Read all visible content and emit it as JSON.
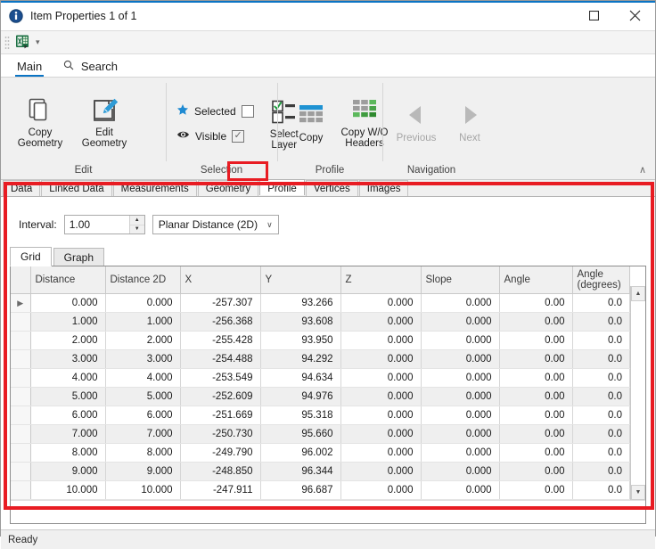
{
  "window": {
    "title": "Item Properties 1 of 1",
    "icon": "info-icon",
    "maximize_label": "□",
    "close_label": "✕"
  },
  "quick_access": {
    "export_excel_icon": "excel-export-icon",
    "dropdown_caret": "▾"
  },
  "ribbon": {
    "tabs": [
      {
        "label": "Main",
        "active": true
      },
      {
        "label": "Search",
        "active": false,
        "icon": "search-icon"
      }
    ],
    "collapse_label": "∧",
    "groups": [
      {
        "name": "Edit",
        "label": "Edit",
        "buttons": [
          {
            "label": "Copy Geometry",
            "icon": "copy-geometry-icon",
            "disabled": false
          },
          {
            "label": "Edit Geometry",
            "icon": "edit-geometry-icon",
            "disabled": false
          }
        ]
      },
      {
        "name": "Selection",
        "label": "Selection",
        "checks": [
          {
            "label": "Selected",
            "icon": "star-icon",
            "checked": false,
            "mark": ""
          },
          {
            "label": "Visible",
            "icon": "eye-icon",
            "checked": true,
            "mark": "✓"
          }
        ],
        "buttons": [
          {
            "label": "Select Layer",
            "icon": "select-layer-icon",
            "disabled": false
          }
        ]
      },
      {
        "name": "Profile",
        "label": "Profile",
        "buttons": [
          {
            "label": "Copy",
            "icon": "copy-table-icon",
            "disabled": false
          },
          {
            "label": "Copy W/O Headers",
            "icon": "copy-no-headers-icon",
            "disabled": false
          }
        ]
      },
      {
        "name": "Navigation",
        "label": "Navigation",
        "buttons": [
          {
            "label": "Previous",
            "icon": "arrow-left-icon",
            "disabled": true
          },
          {
            "label": "Next",
            "icon": "arrow-right-icon",
            "disabled": true
          }
        ]
      }
    ]
  },
  "page_tabs": [
    {
      "label": "Data",
      "active": false
    },
    {
      "label": "Linked Data",
      "active": false
    },
    {
      "label": "Measurements",
      "active": false
    },
    {
      "label": "Geometry",
      "active": false
    },
    {
      "label": "Profile",
      "active": true
    },
    {
      "label": "Vertices",
      "active": false
    },
    {
      "label": "Images",
      "active": false
    }
  ],
  "profile_panel": {
    "interval_label": "Interval:",
    "interval_value": "1.00",
    "interval_placeholder": "",
    "spin_up": "▲",
    "spin_down": "▼",
    "mode_value": "Planar Distance (2D)",
    "mode_caret": "∨",
    "mode_options": [
      "Planar Distance (2D)"
    ],
    "sub_tabs": [
      {
        "label": "Grid",
        "active": true
      },
      {
        "label": "Graph",
        "active": false
      }
    ],
    "row_marker": "▶",
    "scroll_up": "▲",
    "scroll_down": "▼",
    "columns": [
      "Distance",
      "Distance 2D",
      "X",
      "Y",
      "Z",
      "Slope",
      "Angle",
      "Angle (degrees)"
    ],
    "rows": [
      [
        "0.000",
        "0.000",
        "-257.307",
        "93.266",
        "0.000",
        "0.000",
        "0.00",
        "0.0"
      ],
      [
        "1.000",
        "1.000",
        "-256.368",
        "93.608",
        "0.000",
        "0.000",
        "0.00",
        "0.0"
      ],
      [
        "2.000",
        "2.000",
        "-255.428",
        "93.950",
        "0.000",
        "0.000",
        "0.00",
        "0.0"
      ],
      [
        "3.000",
        "3.000",
        "-254.488",
        "94.292",
        "0.000",
        "0.000",
        "0.00",
        "0.0"
      ],
      [
        "4.000",
        "4.000",
        "-253.549",
        "94.634",
        "0.000",
        "0.000",
        "0.00",
        "0.0"
      ],
      [
        "5.000",
        "5.000",
        "-252.609",
        "94.976",
        "0.000",
        "0.000",
        "0.00",
        "0.0"
      ],
      [
        "6.000",
        "6.000",
        "-251.669",
        "95.318",
        "0.000",
        "0.000",
        "0.00",
        "0.0"
      ],
      [
        "7.000",
        "7.000",
        "-250.730",
        "95.660",
        "0.000",
        "0.000",
        "0.00",
        "0.0"
      ],
      [
        "8.000",
        "8.000",
        "-249.790",
        "96.002",
        "0.000",
        "0.000",
        "0.00",
        "0.0"
      ],
      [
        "9.000",
        "9.000",
        "-248.850",
        "96.344",
        "0.000",
        "0.000",
        "0.00",
        "0.0"
      ],
      [
        "10.000",
        "10.000",
        "-247.911",
        "96.687",
        "0.000",
        "0.000",
        "0.00",
        "0.0"
      ]
    ]
  },
  "status": {
    "text": "Ready"
  },
  "colors": {
    "accent": "#0a74c4",
    "annotation": "#e81c23",
    "star": "#1f8ad2",
    "excel_green": "#1e7145",
    "ribbon_bg": "#f0f0f0"
  }
}
